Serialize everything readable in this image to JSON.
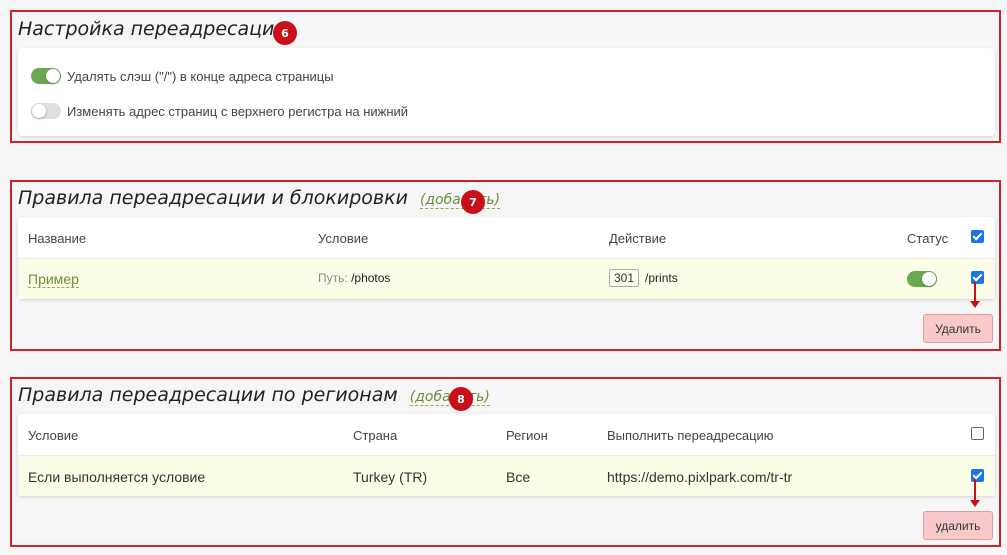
{
  "section1": {
    "title": "Настройка переадресации",
    "badge": "6",
    "toggles": [
      {
        "label": "Удалять слэш (\"/\") в конце адреса страницы",
        "state": "on"
      },
      {
        "label": "Изменять адрес страниц с верхнего регистра на нижний",
        "state": "off"
      }
    ]
  },
  "section2": {
    "title": "Правила переадресации и блокировки",
    "add_label": "(добавить)",
    "badge": "7",
    "headers": {
      "name": "Название",
      "condition": "Условие",
      "action": "Действие",
      "status": "Статус"
    },
    "row": {
      "name": "Пример",
      "condition_prefix": "Путь:",
      "condition_value": "/photos",
      "action_code": "301",
      "action_value": "/prints",
      "status": "on",
      "checked": true
    },
    "header_checked": true,
    "delete_label": "Удалить"
  },
  "section3": {
    "title": "Правила переадресации по регионам",
    "add_label": "(добавить)",
    "badge": "8",
    "headers": {
      "condition": "Условие",
      "country": "Страна",
      "region": "Регион",
      "redirect": "Выполнить переадресацию"
    },
    "row": {
      "condition": "Если выполняется условие",
      "country": "Turkey (TR)",
      "region": "Все",
      "redirect": "https://demo.pixlpark.com/tr-tr",
      "checked": true
    },
    "header_checked": false,
    "delete_label": "удалить"
  },
  "colors": {
    "accent_red": "#d3212b",
    "toggle_on": "#6aa84f",
    "highlight_row": "#fcfde6",
    "delete_bg": "#f9c9c9"
  }
}
